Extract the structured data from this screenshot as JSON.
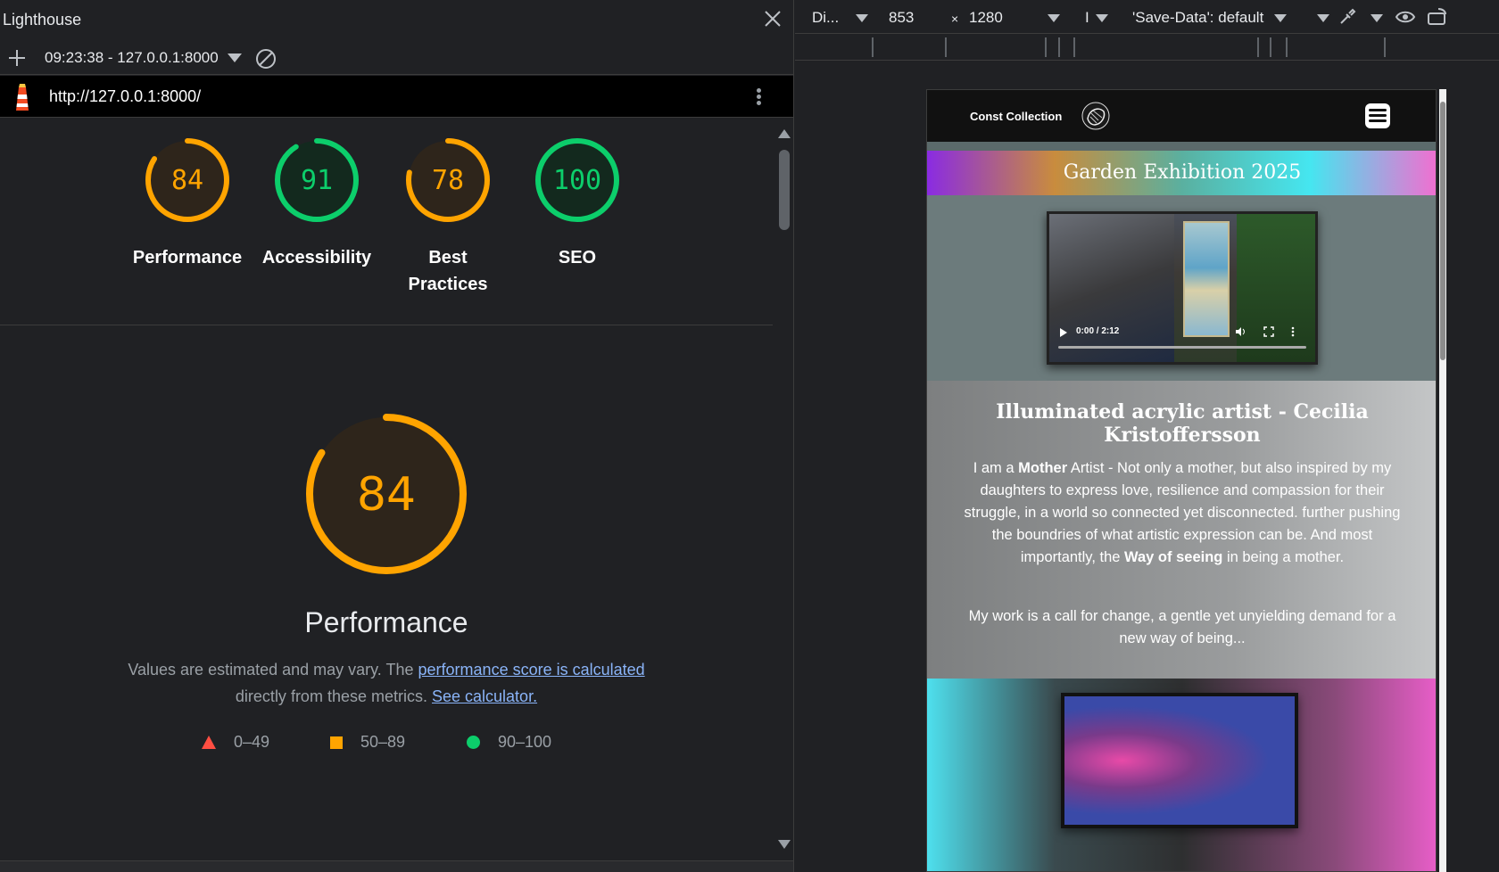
{
  "lighthouse": {
    "panel_title": "Lighthouse",
    "report_selector": "09:23:38 - 127.0.0.1:8000",
    "url": "http://127.0.0.1:8000/",
    "gauges": [
      {
        "label": "Performance",
        "score": 84,
        "color": "#ffa400"
      },
      {
        "label": "Accessibility",
        "score": 91,
        "color": "#0cce6b"
      },
      {
        "label": "Best Practices",
        "score": 78,
        "color": "#ffa400"
      },
      {
        "label": "SEO",
        "score": 100,
        "color": "#0cce6b"
      }
    ],
    "detail": {
      "score": 84,
      "title": "Performance",
      "desc_prefix": "Values are estimated and may vary. The",
      "desc_link": "performance score is calculated",
      "desc_middle": "directly from these metrics.",
      "calculator_link": "See calculator."
    },
    "legend": [
      {
        "range": "0–49",
        "color": "#ff4e42"
      },
      {
        "range": "50–89",
        "color": "#ffa400"
      },
      {
        "range": "90–100",
        "color": "#0cce6b"
      }
    ]
  },
  "device_toolbar": {
    "device": "Di...",
    "width": "853",
    "times": "×",
    "height": "1280",
    "zoom": "I",
    "throttle": "'Save-Data': default"
  },
  "site": {
    "brand": "Const Collection",
    "banner": "Garden Exhibition 2025",
    "video_time": "0:00 / 2:12",
    "heading": "Illuminated acrylic artist - Cecilia Kristoffersson",
    "para1_a": "I am a ",
    "para1_b1": "Mother",
    "para1_c": " Artist - Not only a mother, but also inspired by my daughters to express love, resilience and compassion for their struggle, in a world so connected yet disconnected. further pushing the boundries of what artistic expression can be. And most importantly, the ",
    "para1_b2": "Way of seeing",
    "para1_d": " in being a mother.",
    "para2": "My work is a call for change, a gentle yet unyielding demand for a new way of being..."
  }
}
